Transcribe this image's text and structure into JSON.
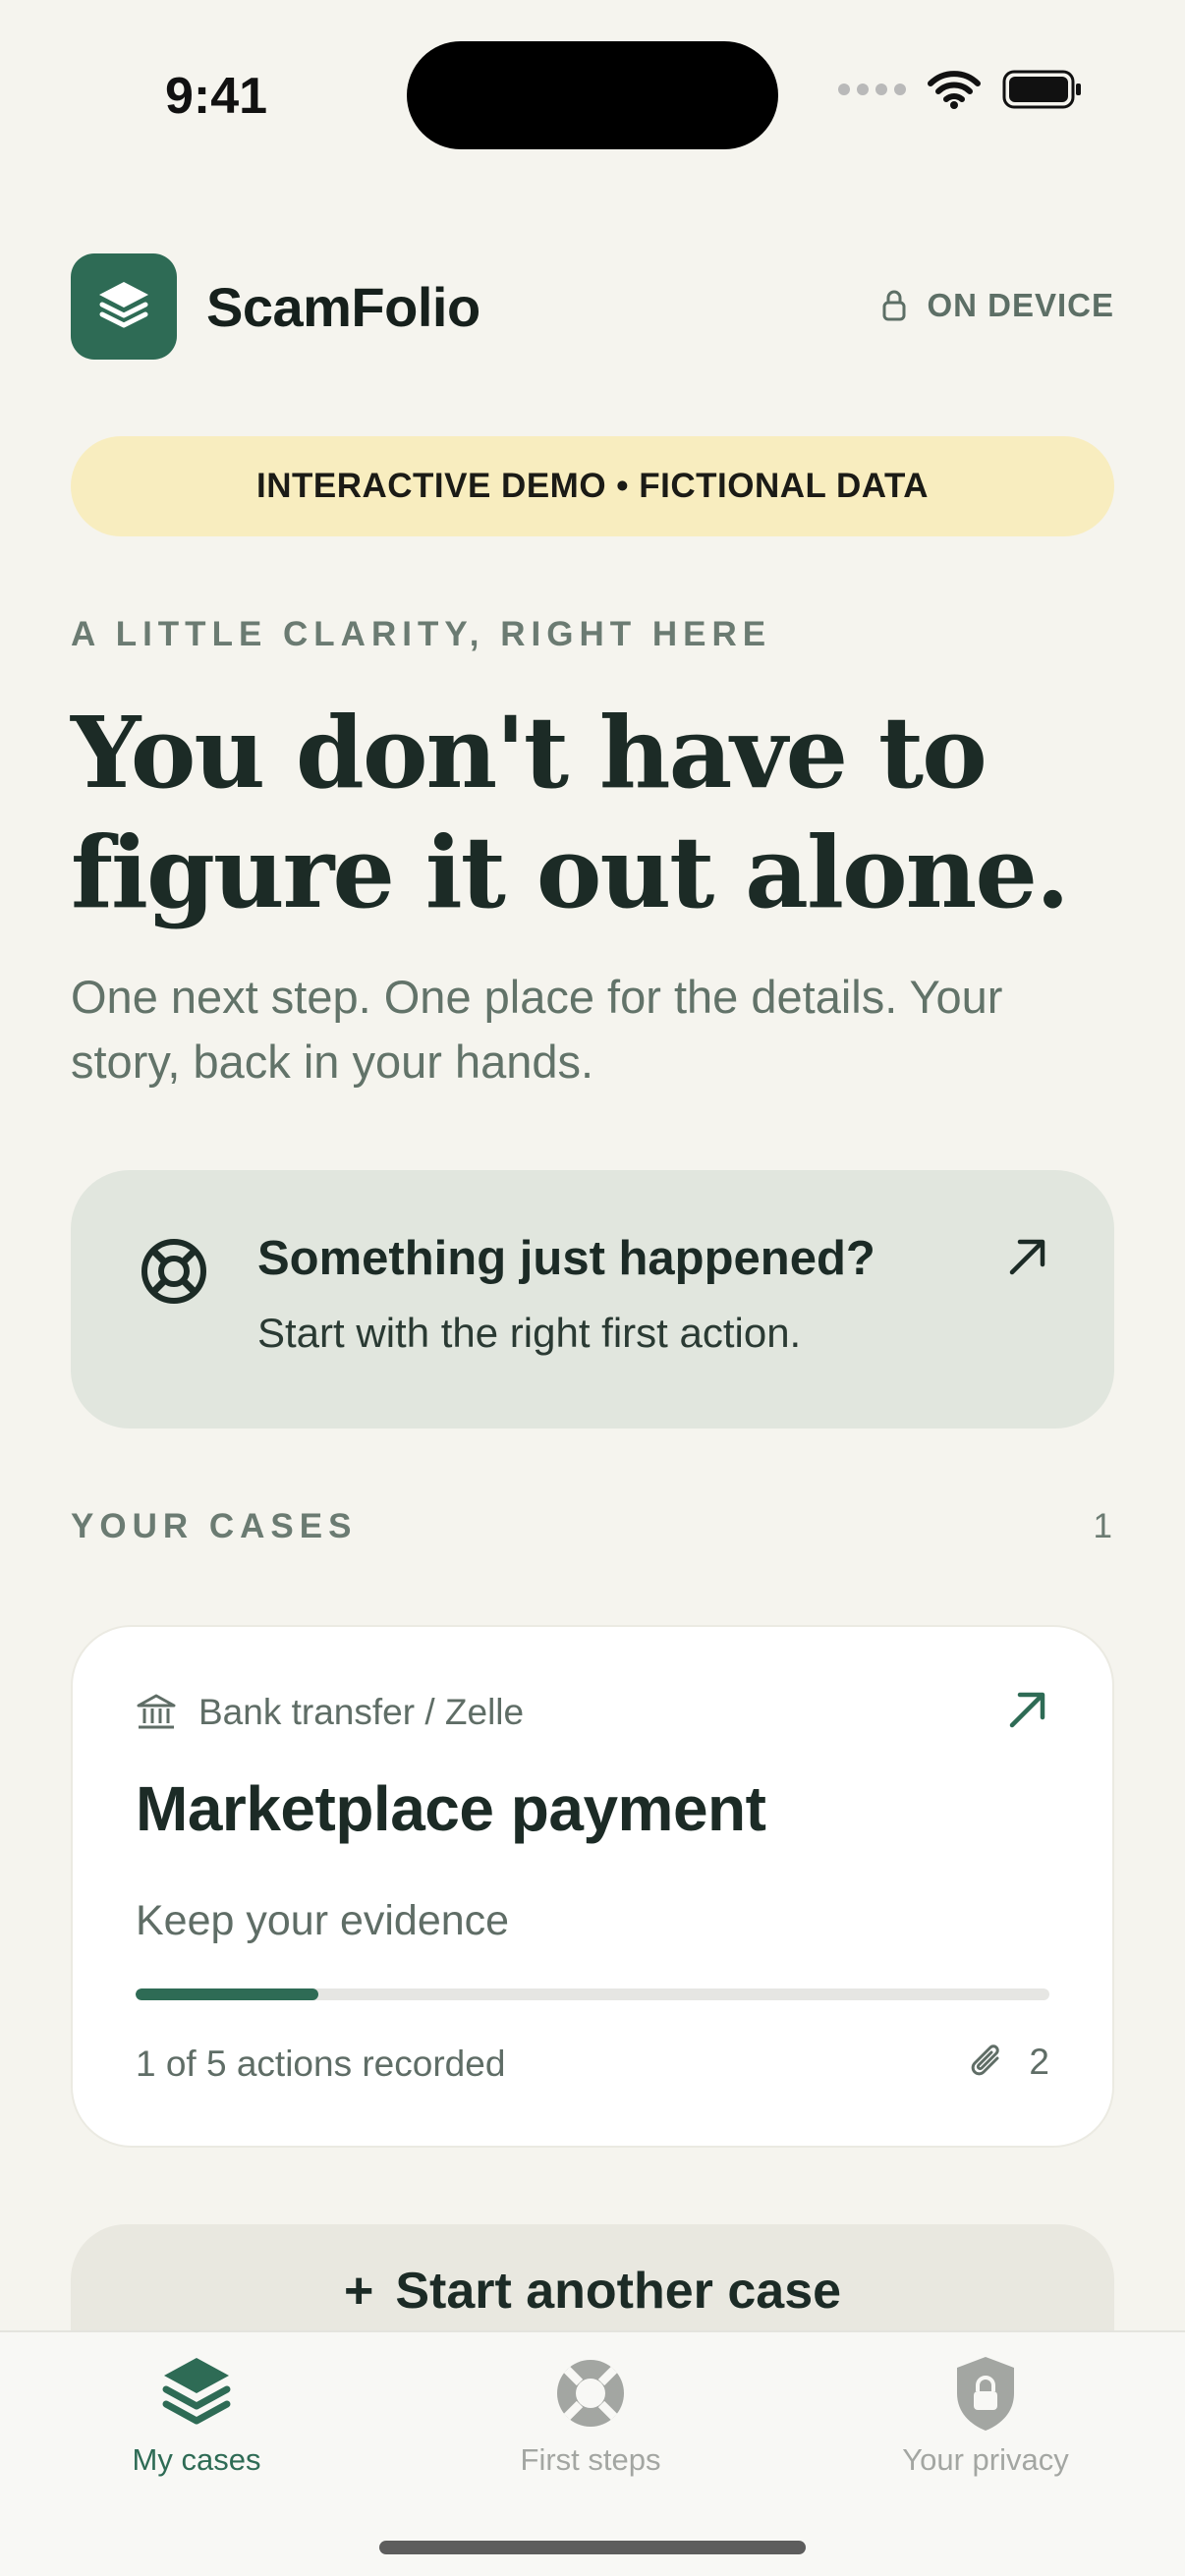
{
  "status_bar": {
    "time": "9:41"
  },
  "header": {
    "app_name": "ScamFolio",
    "storage_label": "ON DEVICE"
  },
  "banner": {
    "text": "INTERACTIVE DEMO • FICTIONAL DATA"
  },
  "hero": {
    "eyebrow": "A LITTLE CLARITY, RIGHT HERE",
    "title": "You don't have to figure it out alone.",
    "subtitle": "One next step. One place for the details. Your story, back in your hands."
  },
  "help_card": {
    "title": "Something just happened?",
    "subtitle": "Start with the right first action."
  },
  "cases": {
    "section_label": "YOUR CASES",
    "count": "1",
    "items": [
      {
        "category": "Bank transfer / Zelle",
        "title": "Marketplace payment",
        "status": "Keep your evidence",
        "progress": 0.2,
        "actions_text": "1 of 5 actions recorded",
        "attachments": "2"
      }
    ]
  },
  "start_button": {
    "icon": "+",
    "label": "Start another case"
  },
  "tabs": [
    {
      "label": "My cases",
      "icon": "layers-icon",
      "active": true
    },
    {
      "label": "First steps",
      "icon": "lifebuoy-icon",
      "active": false
    },
    {
      "label": "Your privacy",
      "icon": "shield-lock-icon",
      "active": false
    }
  ],
  "colors": {
    "accent": "#2e6b55",
    "background": "#f5f4ee",
    "banner": "#f8edbf",
    "help_card": "#e1e6de",
    "inactive_tab": "#a3a6a2"
  }
}
